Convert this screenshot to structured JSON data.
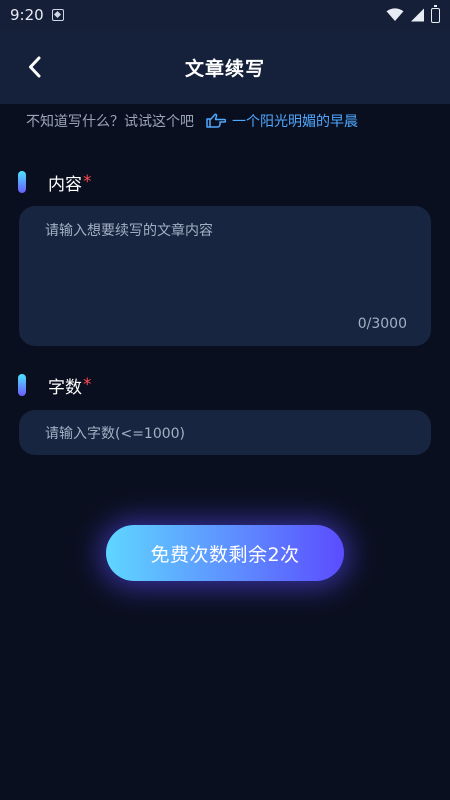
{
  "status_bar": {
    "time": "9:20"
  },
  "header": {
    "title": "文章续写"
  },
  "hint": {
    "prompt_text": "不知道写什么？试试这个吧",
    "suggestion": "一个阳光明媚的早晨"
  },
  "content_section": {
    "label": "内容",
    "required_mark": "*",
    "placeholder": "请输入想要续写的文章内容",
    "counter": "0/3000"
  },
  "word_count_section": {
    "label": "字数",
    "required_mark": "*",
    "placeholder": "请输入字数(<=1000)"
  },
  "submit": {
    "label": "免费次数剩余2次"
  },
  "colors": {
    "background": "#0a0f1f",
    "header": "#15213a",
    "field": "#172540",
    "link": "#4fa8ff",
    "required": "#ff4d4f",
    "button_gradient_start": "#5fd6ff",
    "button_gradient_end": "#5b4cff"
  },
  "icons": [
    "notification-icon",
    "wifi-icon",
    "signal-icon",
    "battery-icon",
    "back-arrow-icon",
    "pointing-hand-icon"
  ]
}
